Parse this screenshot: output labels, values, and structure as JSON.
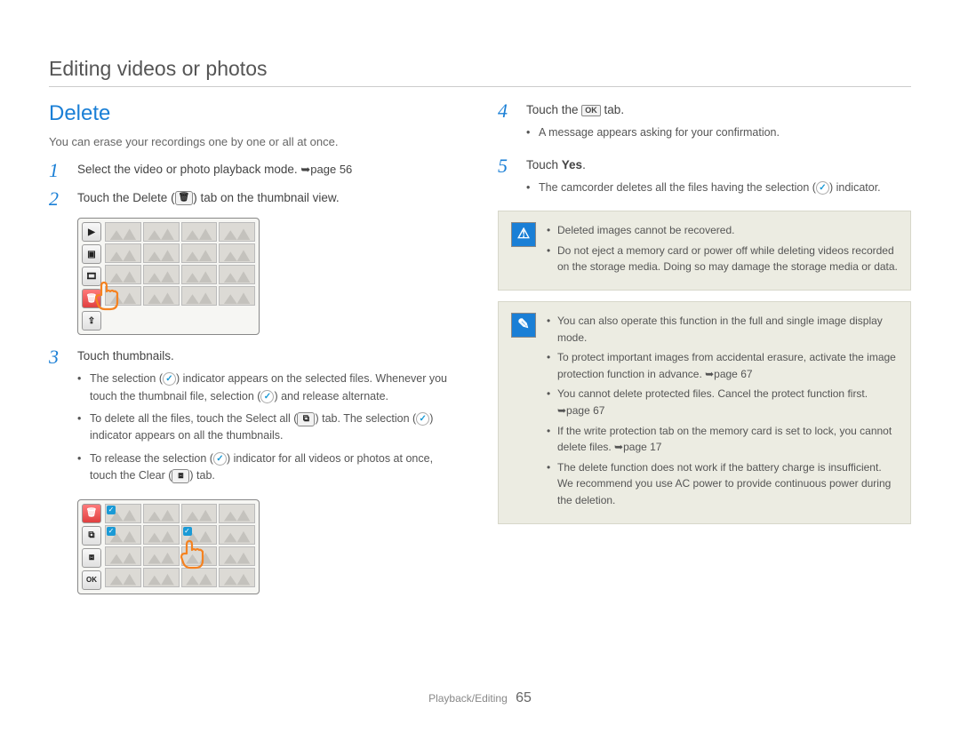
{
  "page_header": "Editing videos or photos",
  "section_title": "Delete",
  "intro": "You can erase your recordings one by one or all at once.",
  "steps": {
    "s1": {
      "num": "1",
      "text_a": "Select the video or photo playback mode. ",
      "ref": "➥page 56"
    },
    "s2": {
      "num": "2",
      "text_a": "Touch the Delete (",
      "text_b": ") tab on the thumbnail view."
    },
    "s3": {
      "num": "3",
      "title": "Touch thumbnails.",
      "b1a": "The selection (",
      "b1b": ") indicator appears on the selected files. Whenever you touch the thumbnail file, selection (",
      "b1c": ") and release alternate.",
      "b2a": "To delete all the files, touch the Select all (",
      "b2b": ") tab. The selection (",
      "b2c": ") indicator appears on all the thumbnails.",
      "b3a": "To release the selection (",
      "b3b": ") indicator for all videos or photos at once, touch the Clear (",
      "b3c": ") tab."
    },
    "s4": {
      "num": "4",
      "text_a": "Touch the ",
      "text_b": " tab.",
      "b1": "A message appears asking for your confirmation."
    },
    "s5": {
      "num": "5",
      "text_a": "Touch ",
      "yes": "Yes",
      "text_b": ".",
      "b1a": "The camcorder deletes all the files having the selection (",
      "b1b": ") indicator."
    }
  },
  "icons": {
    "trash": "🗑",
    "select_all": "⧉",
    "clear": "⧈",
    "ok": "OK"
  },
  "callout_warn": {
    "w1": "Deleted images cannot be recovered.",
    "w2": "Do not eject a memory card or power off while deleting videos recorded on the storage media. Doing so may damage the storage media or data."
  },
  "callout_note": {
    "n1": "You can also operate this function in the full and single image display mode.",
    "n2": "To protect important images from accidental erasure, activate the image protection function in advance. ➥page 67",
    "n3": "You cannot delete protected files. Cancel the protect function first. ➥page 67",
    "n4": "If the write protection tab on the memory card is set to lock, you cannot delete files. ➥page 17",
    "n5": "The delete function does not work if the battery charge is insufficient. We recommend you use AC power to provide continuous power during the deletion."
  },
  "footer": {
    "section": "Playback/Editing",
    "page": "65"
  }
}
